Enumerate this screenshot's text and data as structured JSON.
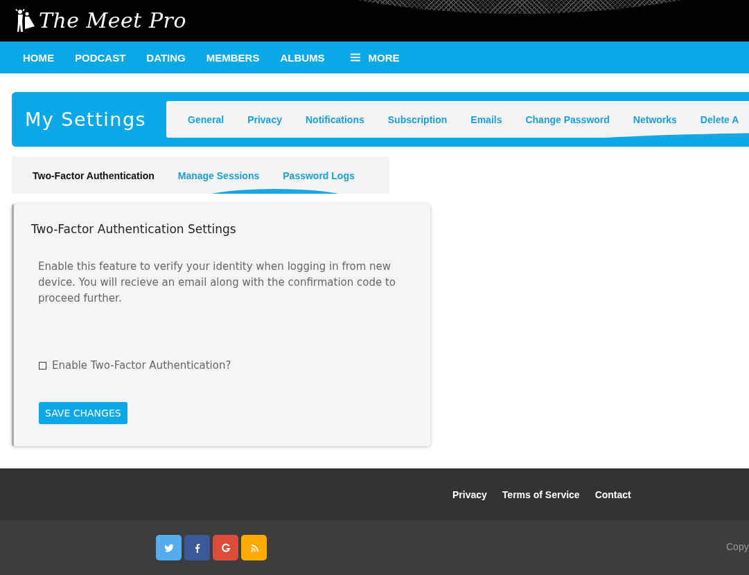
{
  "header": {
    "logo_text": "The Meet Pro"
  },
  "nav": [
    {
      "label": "HOME",
      "kind": "link"
    },
    {
      "label": "PODCAST",
      "kind": "link"
    },
    {
      "label": "DATING",
      "kind": "link"
    },
    {
      "label": "MEMBERS",
      "kind": "link"
    },
    {
      "label": "ALBUMS",
      "kind": "link"
    },
    {
      "label": "MORE",
      "kind": "menu"
    }
  ],
  "settings": {
    "title": "My Settings",
    "tabs": [
      {
        "label": "General"
      },
      {
        "label": "Privacy"
      },
      {
        "label": "Notifications"
      },
      {
        "label": "Subscription"
      },
      {
        "label": "Emails"
      },
      {
        "label": "Change Password"
      },
      {
        "label": "Networks"
      },
      {
        "label": "Delete A"
      }
    ]
  },
  "subtabs": [
    {
      "label": "Two-Factor Authentication",
      "selected": true
    },
    {
      "label": "Manage Sessions",
      "selected": false
    },
    {
      "label": "Password Logs",
      "selected": false
    }
  ],
  "panel": {
    "title": "Two-Factor Authentication Settings",
    "description": "Enable this feature to verify your identity when logging in from new device. You will recieve an email along with the confirmation code to proceed further.",
    "checkbox": {
      "label": "Enable Two-Factor Authentication?",
      "checked": false
    },
    "button": "SAVE CHANGES"
  },
  "footer": {
    "links": [
      "Privacy",
      "Terms of Service",
      "Contact"
    ],
    "social": [
      {
        "kind": "twitter",
        "color": "#55acee"
      },
      {
        "kind": "facebook",
        "color": "#3b5998"
      },
      {
        "kind": "google",
        "color": "#dd4b39"
      },
      {
        "kind": "rss",
        "color": "#ffaa00"
      }
    ],
    "copyright": "Copy"
  }
}
